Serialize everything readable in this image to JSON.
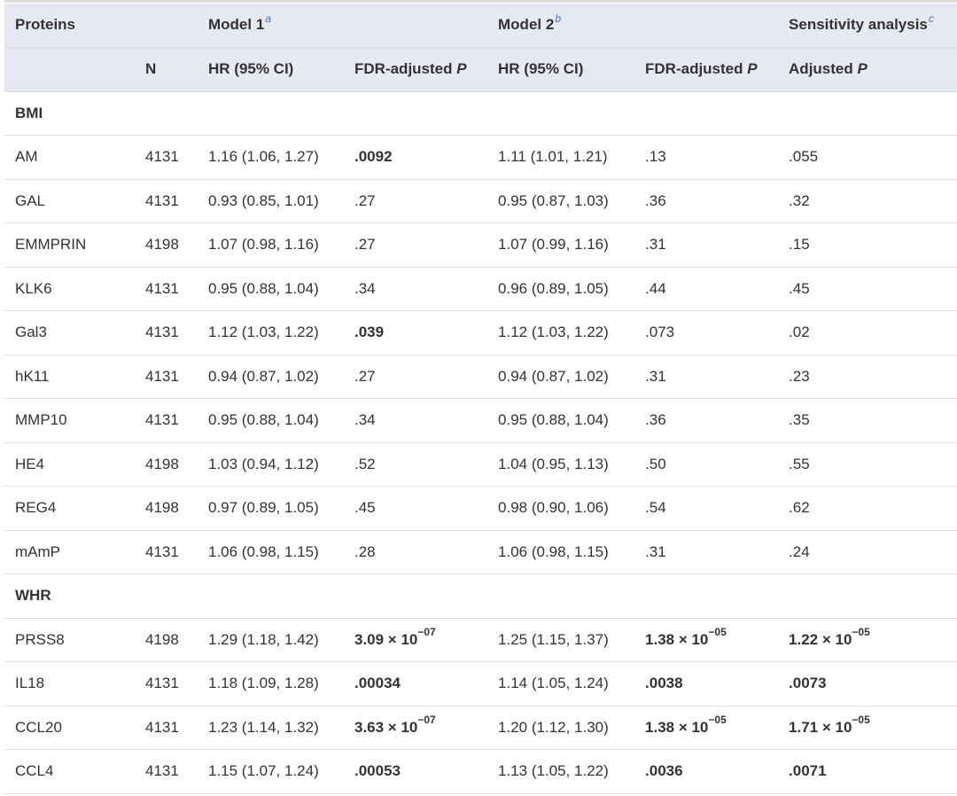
{
  "header": {
    "proteins": "Proteins",
    "model1": "Model 1",
    "model1_fn": "a",
    "model2": "Model 2",
    "model2_fn": "b",
    "sensitivity": "Sensitivity analysis",
    "sensitivity_fn": "c",
    "n": "N",
    "hr1": "HR (95% CI)",
    "fdr1": "FDR-adjusted ",
    "fdr1_p": "P",
    "hr2": "HR (95% CI)",
    "fdr2": "FDR-adjusted ",
    "fdr2_p": "P",
    "adj": "Adjusted ",
    "adj_p": "P"
  },
  "sections": [
    {
      "label": "BMI",
      "rows": [
        {
          "protein": "AM",
          "n": "4131",
          "hr1": "1.16 (1.06, 1.27)",
          "p1": {
            "text": ".0092",
            "bold": true
          },
          "hr2": "1.11 (1.01, 1.21)",
          "p2": {
            "text": ".13"
          },
          "adj": {
            "text": ".055"
          }
        },
        {
          "protein": "GAL",
          "n": "4131",
          "hr1": "0.93 (0.85, 1.01)",
          "p1": {
            "text": ".27"
          },
          "hr2": "0.95 (0.87, 1.03)",
          "p2": {
            "text": ".36"
          },
          "adj": {
            "text": ".32"
          }
        },
        {
          "protein": "EMMPRIN",
          "n": "4198",
          "hr1": "1.07 (0.98, 1.16)",
          "p1": {
            "text": ".27"
          },
          "hr2": "1.07 (0.99, 1.16)",
          "p2": {
            "text": ".31"
          },
          "adj": {
            "text": ".15"
          }
        },
        {
          "protein": "KLK6",
          "n": "4131",
          "hr1": "0.95 (0.88, 1.04)",
          "p1": {
            "text": ".34"
          },
          "hr2": "0.96 (0.89, 1.05)",
          "p2": {
            "text": ".44"
          },
          "adj": {
            "text": ".45"
          }
        },
        {
          "protein": "Gal3",
          "n": "4131",
          "hr1": "1.12 (1.03, 1.22)",
          "p1": {
            "text": ".039",
            "bold": true
          },
          "hr2": "1.12 (1.03, 1.22)",
          "p2": {
            "text": ".073"
          },
          "adj": {
            "text": ".02"
          }
        },
        {
          "protein": "hK11",
          "n": "4131",
          "hr1": "0.94 (0.87, 1.02)",
          "p1": {
            "text": ".27"
          },
          "hr2": "0.94 (0.87, 1.02)",
          "p2": {
            "text": ".31"
          },
          "adj": {
            "text": ".23"
          }
        },
        {
          "protein": "MMP10",
          "n": "4131",
          "hr1": "0.95 (0.88, 1.04)",
          "p1": {
            "text": ".34"
          },
          "hr2": "0.95 (0.88, 1.04)",
          "p2": {
            "text": ".36"
          },
          "adj": {
            "text": ".35"
          }
        },
        {
          "protein": "HE4",
          "n": "4198",
          "hr1": "1.03 (0.94, 1.12)",
          "p1": {
            "text": ".52"
          },
          "hr2": "1.04 (0.95, 1.13)",
          "p2": {
            "text": ".50"
          },
          "adj": {
            "text": ".55"
          }
        },
        {
          "protein": "REG4",
          "n": "4198",
          "hr1": "0.97 (0.89, 1.05)",
          "p1": {
            "text": ".45"
          },
          "hr2": "0.98 (0.90, 1.06)",
          "p2": {
            "text": ".54"
          },
          "adj": {
            "text": ".62"
          }
        },
        {
          "protein": "mAmP",
          "n": "4131",
          "hr1": "1.06 (0.98, 1.15)",
          "p1": {
            "text": ".28"
          },
          "hr2": "1.06 (0.98, 1.15)",
          "p2": {
            "text": ".31"
          },
          "adj": {
            "text": ".24"
          }
        }
      ]
    },
    {
      "label": "WHR",
      "rows": [
        {
          "protein": "PRSS8",
          "n": "4198",
          "hr1": "1.29 (1.18, 1.42)",
          "p1": {
            "text": "3.09 × 10",
            "exp": "−07",
            "bold": true
          },
          "hr2": "1.25 (1.15, 1.37)",
          "p2": {
            "text": "1.38 × 10",
            "exp": "−05",
            "bold": true
          },
          "adj": {
            "text": "1.22 × 10",
            "exp": "−05",
            "bold": true
          }
        },
        {
          "protein": "IL18",
          "n": "4131",
          "hr1": "1.18 (1.09, 1.28)",
          "p1": {
            "text": ".00034",
            "bold": true
          },
          "hr2": "1.14 (1.05, 1.24)",
          "p2": {
            "text": ".0038",
            "bold": true
          },
          "adj": {
            "text": ".0073",
            "bold": true
          }
        },
        {
          "protein": "CCL20",
          "n": "4131",
          "hr1": "1.23 (1.14, 1.32)",
          "p1": {
            "text": "3.63 × 10",
            "exp": "−07",
            "bold": true
          },
          "hr2": "1.20 (1.12, 1.30)",
          "p2": {
            "text": "1.38 × 10",
            "exp": "−05",
            "bold": true
          },
          "adj": {
            "text": "1.71 × 10",
            "exp": "−05",
            "bold": true
          }
        },
        {
          "protein": "CCL4",
          "n": "4131",
          "hr1": "1.15 (1.07, 1.24)",
          "p1": {
            "text": ".00053",
            "bold": true
          },
          "hr2": "1.13 (1.05, 1.22)",
          "p2": {
            "text": ".0036",
            "bold": true
          },
          "adj": {
            "text": ".0071",
            "bold": true
          }
        }
      ]
    }
  ]
}
